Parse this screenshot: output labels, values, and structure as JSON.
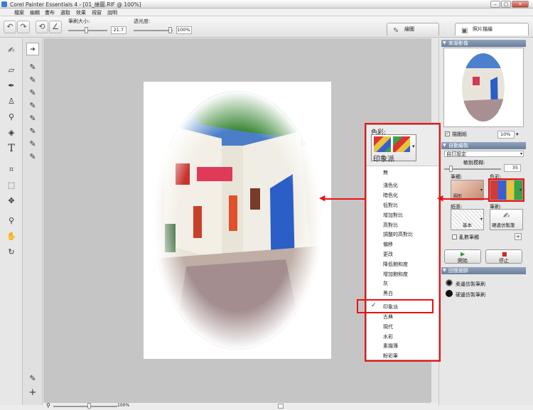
{
  "window": {
    "title": "Corel Painter Essentials 4 - [01_繪圖.RIF @ 100%]"
  },
  "menu": [
    "檔案",
    "編輯",
    "畫布",
    "選取",
    "效果",
    "視窗",
    "說明"
  ],
  "propbar": {
    "brush_size_label": "筆刷大小:",
    "brush_size_value": "21.7",
    "opacity_label": "透光度:",
    "opacity_value": "100%"
  },
  "tabs": {
    "draw": "繪圖",
    "photo": "照片描繪"
  },
  "zoom": {
    "value": "100%"
  },
  "source": {
    "header": "來源影像",
    "tracing_label": "描圖紙",
    "tracing_value": "10%"
  },
  "auto_paint": {
    "header": "自動繪製",
    "preset": "自訂設定",
    "sensitivity_label": "敏銳模糊:",
    "sensitivity_value": "35",
    "stroke_label": "筆觸:",
    "stroke_name": "圓形",
    "color_label": "色彩:",
    "paper_label": "紙張:",
    "paper_name": "基本",
    "brush_label": "筆刷:",
    "brush_name": "硬邊仿製筆",
    "random_label": "亂數筆觸",
    "start_label": "開始",
    "stop_label": "停止"
  },
  "restore": {
    "header": "回復細節",
    "opt1": "柔邊仿製筆刷",
    "opt2": "硬邊仿製筆刷"
  },
  "popup": {
    "title": "色彩:",
    "current": "印象派",
    "options": [
      "無",
      "淺色化",
      "暗色化",
      "低對比",
      "增加對比",
      "高對比",
      "調整的高對比",
      "偏移",
      "更改",
      "降低飽和度",
      "增加飽和度",
      "灰",
      "黑白",
      "印象派",
      "古典",
      "現代",
      "水彩",
      "素描簿",
      "粉彩筆"
    ],
    "selected": "印象派"
  },
  "colors": {
    "highlight": "#e11111",
    "panel_header": "#7a8ca8"
  }
}
